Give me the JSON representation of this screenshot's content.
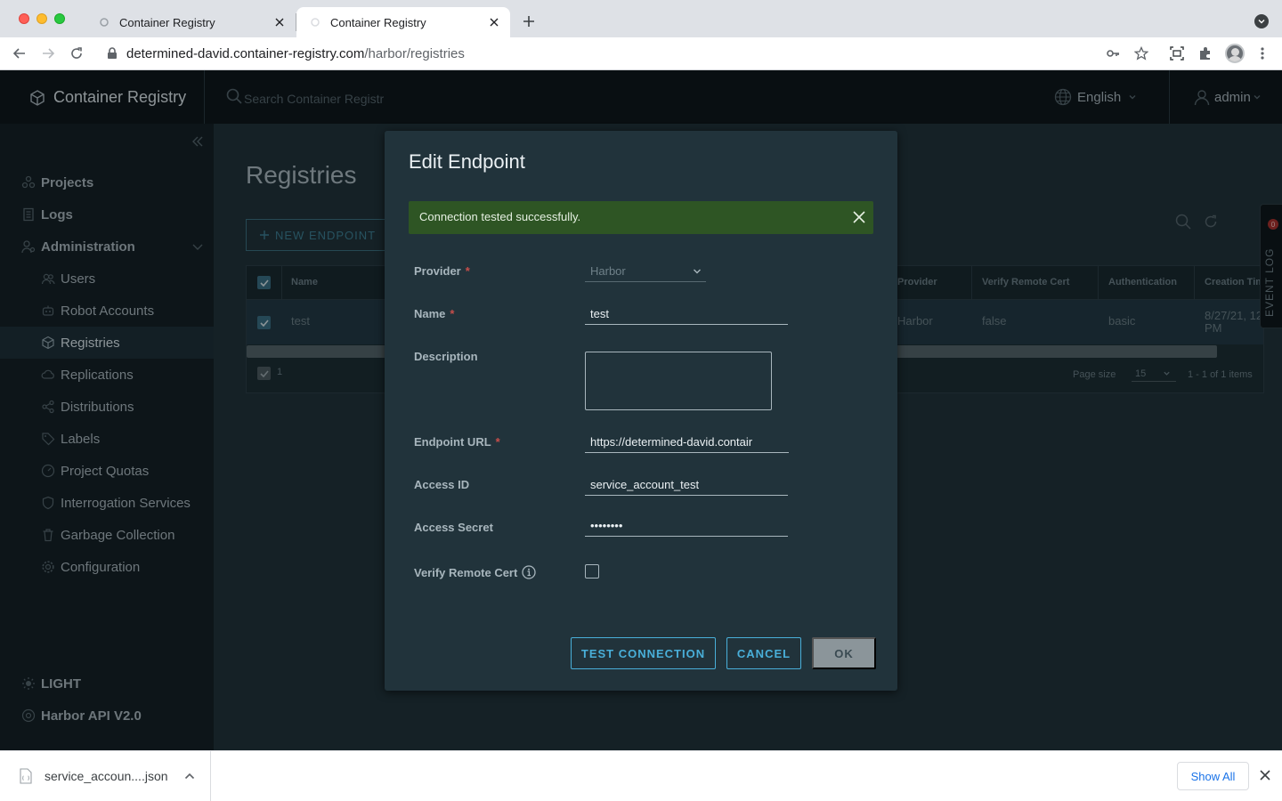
{
  "browser": {
    "tabs": [
      {
        "title": "Container Registry",
        "active": false
      },
      {
        "title": "Container Registry",
        "active": true
      }
    ],
    "url_host": "determined-david.container-registry.com",
    "url_path": "/harbor/registries"
  },
  "app": {
    "brand": "Container Registry",
    "search_placeholder": "Search Container Registr",
    "language": "English",
    "user": "admin"
  },
  "sidebar": {
    "projects": "Projects",
    "logs": "Logs",
    "administration": "Administration",
    "sub_items": [
      "Users",
      "Robot Accounts",
      "Registries",
      "Replications",
      "Distributions",
      "Labels",
      "Project Quotas",
      "Interrogation Services",
      "Garbage Collection",
      "Configuration"
    ],
    "theme": "LIGHT",
    "api": "Harbor API V2.0"
  },
  "page": {
    "title": "Registries",
    "new_endpoint": "NEW ENDPOINT",
    "columns": {
      "name": "Name",
      "provider": "Provider",
      "verify": "Verify Remote Cert",
      "auth": "Authentication",
      "created": "Creation Tim"
    },
    "row": {
      "name": "test",
      "provider": "Harbor",
      "verify": "false",
      "auth": "basic",
      "created_line1": "8/27/21, 12",
      "created_line2": "PM"
    },
    "footer": {
      "selected": "1",
      "page_size_label": "Page size",
      "page_size": "15",
      "range": "1 - 1 of 1 items"
    },
    "event_log": "EVENT LOG",
    "event_badge": "0"
  },
  "modal": {
    "title": "Edit Endpoint",
    "alert": "Connection tested successfully.",
    "fields": {
      "provider_label": "Provider",
      "provider_value": "Harbor",
      "name_label": "Name",
      "name_value": "test",
      "description_label": "Description",
      "url_label": "Endpoint URL",
      "url_value": "https://determined-david.contair",
      "access_id_label": "Access ID",
      "access_id_value": "service_account_test",
      "secret_label": "Access Secret",
      "secret_value": "••••••••",
      "verify_label": "Verify Remote Cert"
    },
    "required_mark": "*",
    "buttons": {
      "test": "TEST CONNECTION",
      "cancel": "CANCEL",
      "ok": "OK"
    }
  },
  "download": {
    "file": "service_accoun....json",
    "show_all": "Show All"
  },
  "colors": {
    "accent": "#49afd9",
    "success_bg": "#2e5524",
    "required": "#c64e4b"
  }
}
